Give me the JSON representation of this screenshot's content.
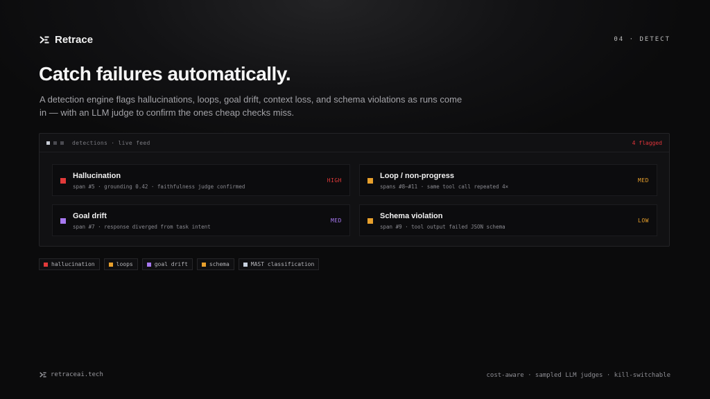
{
  "brand": {
    "name": "Retrace",
    "icon": "retrace-logo-icon"
  },
  "section": {
    "tag": "04 · DETECT"
  },
  "headline": {
    "title": "Catch failures automatically.",
    "subtitle": "A detection engine flags hallucinations, loops, goal drift, context loss, and schema violations as runs come in — with an LLM judge to confirm the ones cheap checks miss."
  },
  "panel": {
    "header_label": "detections · live feed",
    "flagged_label": "4 flagged",
    "flagged_color": "#e0343a",
    "dot_colors": [
      "#c8ccd6",
      "#4a4a50",
      "#4a4a50"
    ]
  },
  "detections": [
    {
      "title": "Hallucination",
      "meta": "span #5 · grounding 0.42 · faithfulness judge confirmed",
      "severity": "HIGH",
      "color": "#e23a3a",
      "severity_color": "#e23a3a"
    },
    {
      "title": "Loop / non-progress",
      "meta": "spans #8–#11 · same tool call repeated 4×",
      "severity": "MED",
      "color": "#e8a02c",
      "severity_color": "#e8a02c"
    },
    {
      "title": "Goal drift",
      "meta": "span #7 · response diverged from task intent",
      "severity": "MED",
      "color": "#a778f0",
      "severity_color": "#a778f0"
    },
    {
      "title": "Schema violation",
      "meta": "span #9 · tool output failed JSON schema",
      "severity": "LOW",
      "color": "#e8a02c",
      "severity_color": "#e8a02c"
    }
  ],
  "legend": [
    {
      "label": "hallucination",
      "color": "#e23a3a"
    },
    {
      "label": "loops",
      "color": "#e8a02c"
    },
    {
      "label": "goal drift",
      "color": "#a778f0"
    },
    {
      "label": "schema",
      "color": "#e8a02c"
    },
    {
      "label": "MAST classification",
      "color": "#c8d2e0"
    }
  ],
  "footer": {
    "url": "retraceai.tech",
    "tagline": "cost-aware · sampled LLM judges · kill-switchable"
  }
}
